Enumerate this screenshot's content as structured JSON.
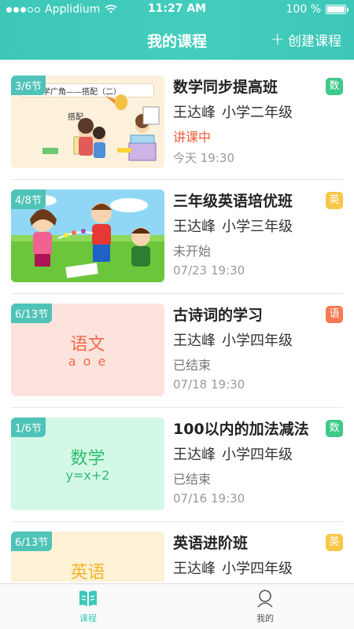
{
  "status_bar": {
    "carrier": "Applidium",
    "time": "11:27 AM",
    "battery": "100 %"
  },
  "header": {
    "title": "我的课程",
    "create_label": "创建课程"
  },
  "courses": [
    {
      "chip": "3/6节",
      "title": "数学同步提高班",
      "teacher": "王达峰",
      "grade": "小学二年级",
      "status": "讲课中",
      "datetime": "今天 19:30",
      "subject": "数",
      "subject_color": "#3fc98a",
      "thumb_caption": "数学广角——搭配（二）",
      "thumb_sub": "搭配"
    },
    {
      "chip": "4/8节",
      "title": "三年级英语培优班",
      "teacher": "王达峰",
      "grade": "小学三年级",
      "status": "未开始",
      "datetime": "07/23 19:30",
      "subject": "英",
      "subject_color": "#f7c74a"
    },
    {
      "chip": "6/13节",
      "title": "古诗词的学习",
      "teacher": "王达峰",
      "grade": "小学四年级",
      "status": "已结束",
      "datetime": "07/18 19:30",
      "subject": "语",
      "subject_color": "#f57a55",
      "thumb_big": "语文",
      "thumb_small": "a o e"
    },
    {
      "chip": "1/6节",
      "title": "100以内的加法减法",
      "teacher": "王达峰",
      "grade": "小学四年级",
      "status": "已结束",
      "datetime": "07/16 19:30",
      "subject": "数",
      "subject_color": "#3fc98a",
      "thumb_big": "数学",
      "thumb_small": "y=x+2"
    },
    {
      "chip": "6/13节",
      "title": "英语进阶班",
      "teacher": "王达峰",
      "grade": "小学四年级",
      "status": "",
      "datetime": "",
      "subject": "英",
      "subject_color": "#f7c74a",
      "thumb_big": "英语"
    }
  ],
  "tabbar": {
    "courses_label": "课程",
    "mine_label": "我的",
    "active_color": "#3cc7b9"
  }
}
